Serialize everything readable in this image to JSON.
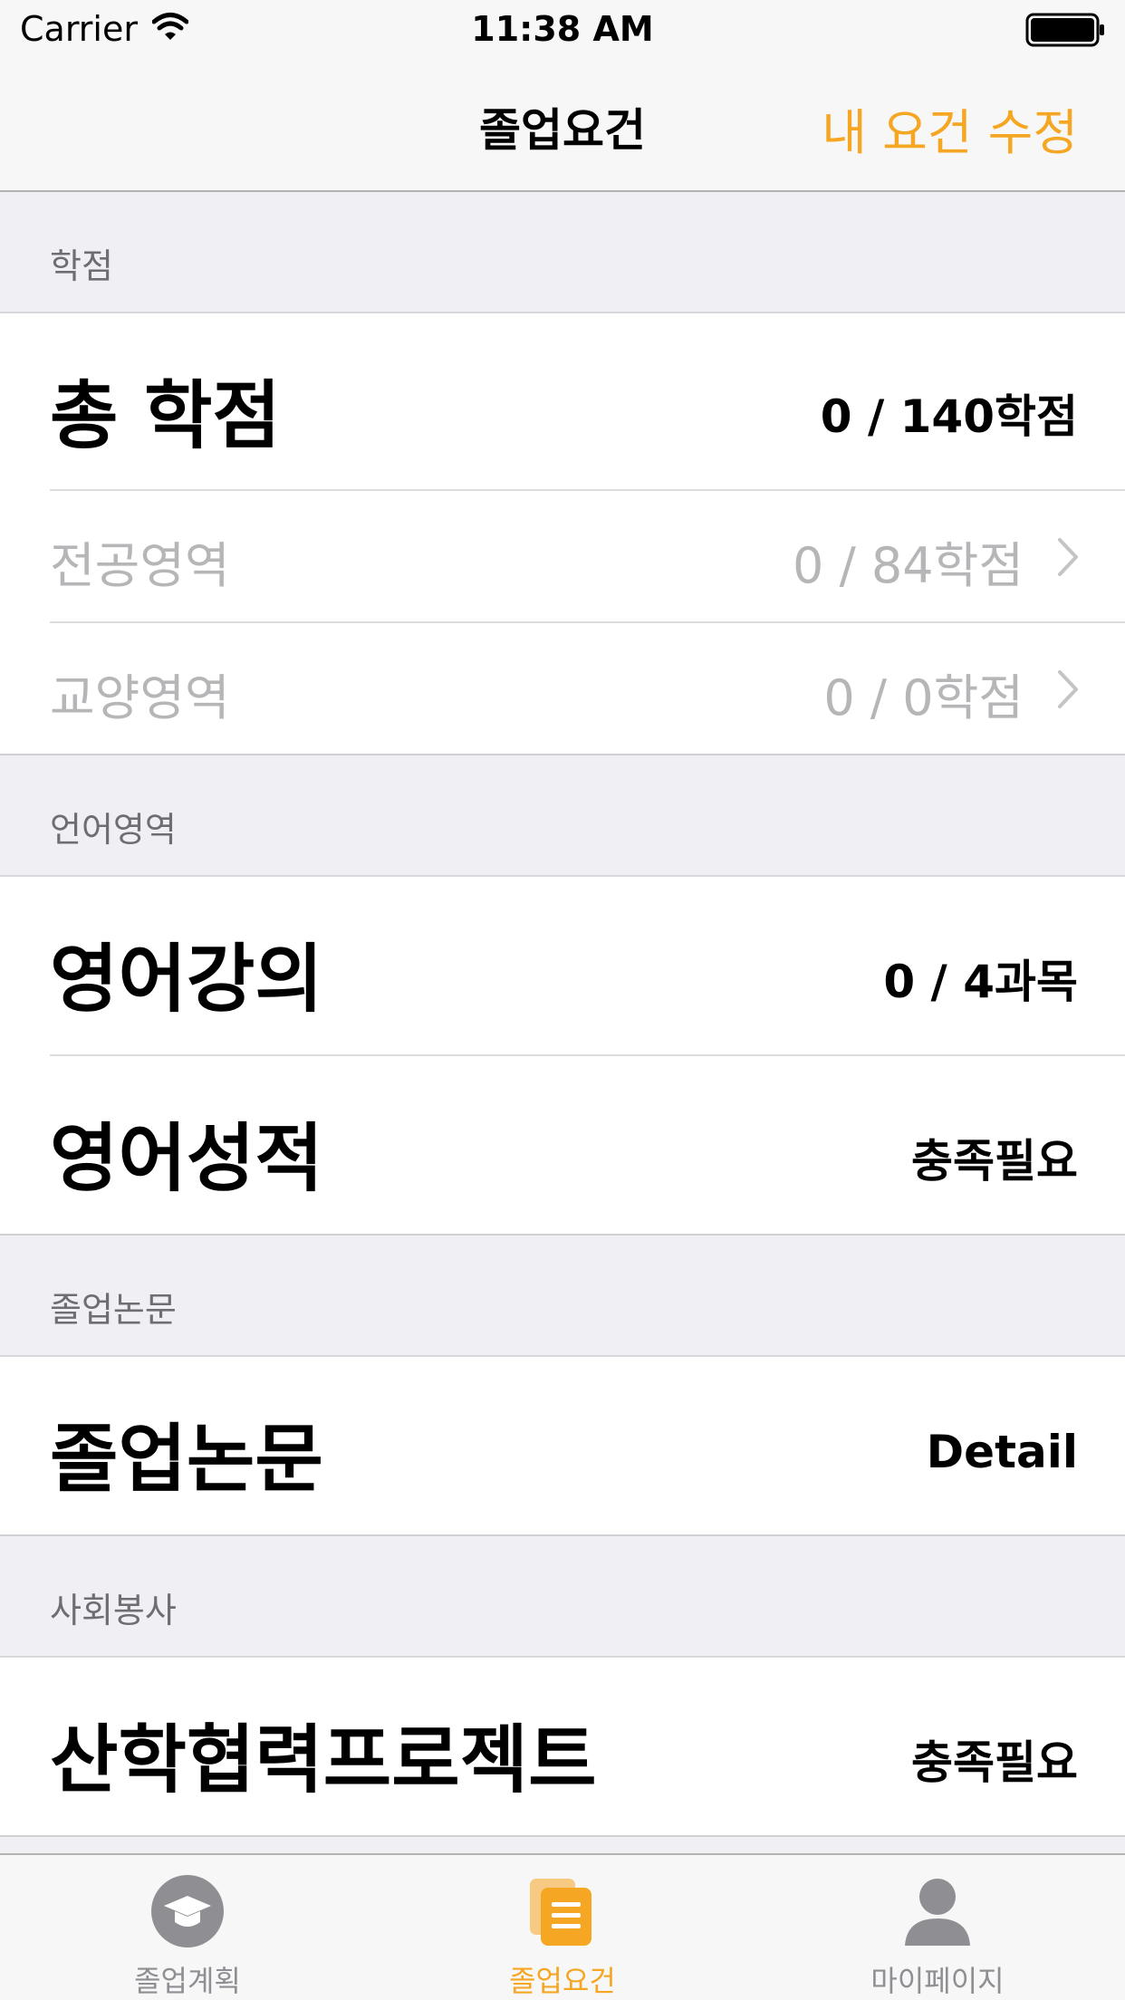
{
  "status_bar": {
    "carrier": "Carrier",
    "time": "11:38 AM"
  },
  "nav": {
    "title": "졸업요건",
    "action": "내 요건 수정"
  },
  "sections": {
    "credits": {
      "header": "학점",
      "total": {
        "label": "총 학점",
        "value": "0 / 140학점"
      },
      "major": {
        "label": "전공영역",
        "value": "0 / 84학점"
      },
      "liberal": {
        "label": "교양영역",
        "value": "0 / 0학점"
      }
    },
    "language": {
      "header": "언어영역",
      "english_courses": {
        "label": "영어강의",
        "value": "0 / 4과목"
      },
      "english_score": {
        "label": "영어성적",
        "value": "충족필요"
      }
    },
    "thesis": {
      "header": "졸업논문",
      "thesis_row": {
        "label": "졸업논문",
        "value": "Detail"
      }
    },
    "service": {
      "header": "사회봉사",
      "project_row": {
        "label": "산학협력프로젝트",
        "value": "충족필요"
      }
    }
  },
  "tabs": [
    {
      "label": "졸업계획",
      "icon": "graduation-cap-icon",
      "active": false
    },
    {
      "label": "졸업요건",
      "icon": "document-stack-icon",
      "active": true
    },
    {
      "label": "마이페이지",
      "icon": "person-icon",
      "active": false
    }
  ],
  "colors": {
    "accent": "#f5a623",
    "inactive": "#8e8e93",
    "background": "#efeff4"
  }
}
